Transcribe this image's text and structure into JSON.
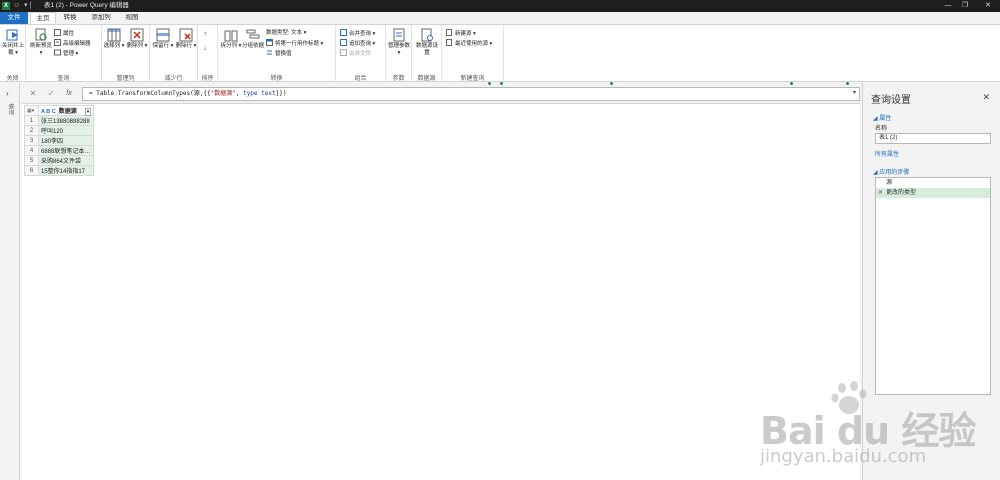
{
  "window": {
    "title": "表1 (2) - Power Query 编辑器",
    "app_badge": "X",
    "smile": "☺",
    "minimize": "—",
    "restore": "❐",
    "close": "✕"
  },
  "tabs": [
    "文件",
    "主页",
    "转换",
    "添加列",
    "视图"
  ],
  "ribbon": {
    "close_load": "关闭并上载 ▾",
    "refresh_preview": "刷新预览 ▾",
    "properties": "属性",
    "advanced_editor": "高级编辑器",
    "manage": "管理 ▾",
    "choose_columns": "选择列 ▾",
    "remove_columns": "删除列 ▾",
    "keep_rows": "保留行 ▾",
    "remove_rows": "删除行 ▾",
    "sort_asc": "↑",
    "sort_desc": "↓",
    "split_column": "拆分列 ▾",
    "group_by": "分组依据",
    "data_type": "数据类型: 文本 ▾",
    "first_row_header": "将第一行用作标题 ▾",
    "replace_values": "替换值",
    "merge_queries": "合并查询 ▾",
    "append_queries": "追加查询 ▾",
    "combine_files": "合并文件",
    "manage_params": "管理参数 ▾",
    "datasource_settings": "数据源设置",
    "new_source": "新建源 ▾",
    "recent_sources": "最近使用的源 ▾",
    "groups": {
      "close": "关闭",
      "query": "查询",
      "manage_columns": "管理列",
      "reduce_rows": "减少行",
      "sort": "排序",
      "transform": "转换",
      "combine": "组合",
      "parameters": "参数",
      "data_source": "数据源",
      "new_query": "新建查询"
    }
  },
  "left_pane": {
    "expand": "›",
    "label": "查询"
  },
  "formula_bar": {
    "cancel": "✕",
    "commit": "✓",
    "fx": "fx",
    "prefix": "= Table.TransformColumnTypes(源,{{",
    "string": "\"数据源\"",
    "mid": ", ",
    "keyword": "type text",
    "suffix": "}})",
    "expand": "▾"
  },
  "table": {
    "corner": "▦▾",
    "column_type": "A B C",
    "column": "数据源",
    "column_dropdown": "▾",
    "rows": [
      "张三13880888288",
      "呼叫120",
      "180李四",
      "6888联想笔记本…",
      "采购864文件袋",
      "15整你14指指17"
    ]
  },
  "query_settings": {
    "title": "查询设置",
    "close": "✕",
    "properties": "◢ 属性",
    "name_label": "名称",
    "name_value": "表1 (2)",
    "all_properties": "所有属性",
    "applied_steps": "◢ 应用的步骤",
    "steps": [
      "源",
      "更改的类型"
    ],
    "delete_step": "✕"
  },
  "watermark": {
    "brand": "Bai du 经验",
    "site": "jingyan.baidu.com"
  }
}
